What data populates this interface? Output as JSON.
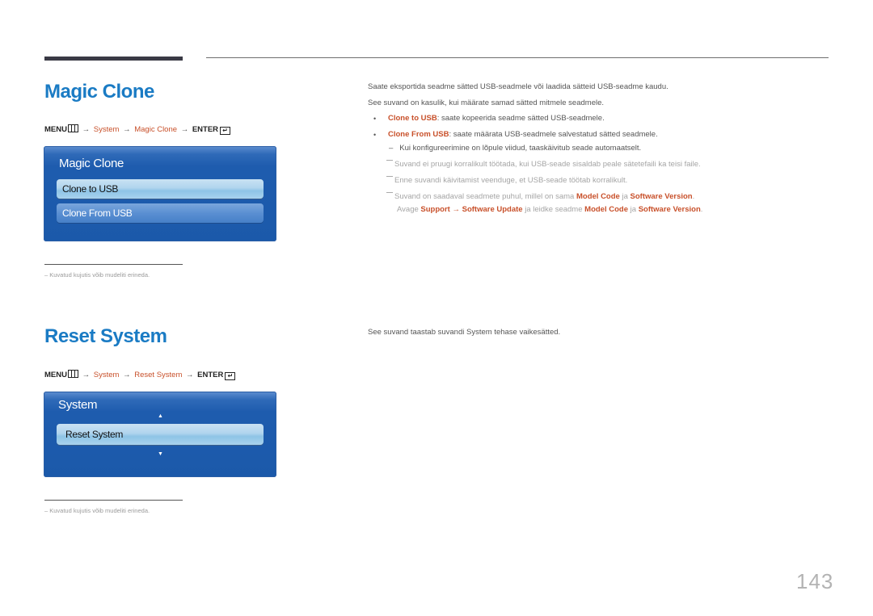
{
  "page_number": "143",
  "sections": {
    "magic_clone": {
      "title": "Magic Clone",
      "menu_path": {
        "menu": "MENU",
        "arrow": "→",
        "step1": "System",
        "step2": "Magic Clone",
        "enter": "ENTER",
        "enter_icon": "↵"
      },
      "osd": {
        "title": "Magic Clone",
        "items": [
          {
            "label": "Clone to USB",
            "state": "selected"
          },
          {
            "label": "Clone From USB",
            "state": "normal"
          }
        ]
      },
      "footnote": "– Kuvatud kujutis võib mudeliti erineda.",
      "description": {
        "line1": "Saate eksportida seadme sätted USB-seadmele või laadida sätteid USB-seadme kaudu.",
        "line2": "See suvand on kasulik, kui määrate samad sätted mitmele seadmele.",
        "bullets": [
          {
            "term": "Clone to USB",
            "text": ": saate kopeerida seadme sätted USB-seadmele."
          },
          {
            "term": "Clone From USB",
            "text": ": saate määrata USB-seadmele salvestatud sätted seadmele."
          }
        ],
        "sub_bullet": "Kui konfigureerimine on lõpule viidud, taaskäivitub seade automaatselt.",
        "notes": {
          "note1": "Suvand ei pruugi korralikult töötada, kui USB-seade sisaldab peale sätetefaili ka teisi faile.",
          "note2": "Enne suvandi käivitamist veenduge, et USB-seade töötab korralikult.",
          "note3": {
            "p1": "Suvand on saadaval seadmete puhul, millel on sama ",
            "t1": "Model Code",
            "p2": " ja ",
            "t2": "Software Version",
            "p3": ".",
            "l2_p1": "Avage ",
            "l2_t1": "Support",
            "l2_arrow": " → ",
            "l2_t2": "Software Update",
            "l2_p2": " ja leidke seadme ",
            "l2_t3": "Model Code",
            "l2_p3": " ja ",
            "l2_t4": "Software Version",
            "l2_p4": "."
          }
        }
      }
    },
    "reset_system": {
      "title": "Reset System",
      "menu_path": {
        "menu": "MENU",
        "arrow": "→",
        "step1": "System",
        "step2": "Reset System",
        "enter": "ENTER",
        "enter_icon": "↵"
      },
      "osd": {
        "title": "System",
        "up_arrow": "▲",
        "down_arrow": "▼",
        "items": [
          {
            "label": "Reset System",
            "state": "selected"
          }
        ]
      },
      "footnote": "– Kuvatud kujutis võib mudeliti erineda.",
      "description": "See suvand taastab suvandi System tehase vaikesätted."
    }
  },
  "colors": {
    "title_blue": "#1a7bc4",
    "highlight_orange": "#c8502a",
    "osd_blue": "#1b59aa"
  }
}
